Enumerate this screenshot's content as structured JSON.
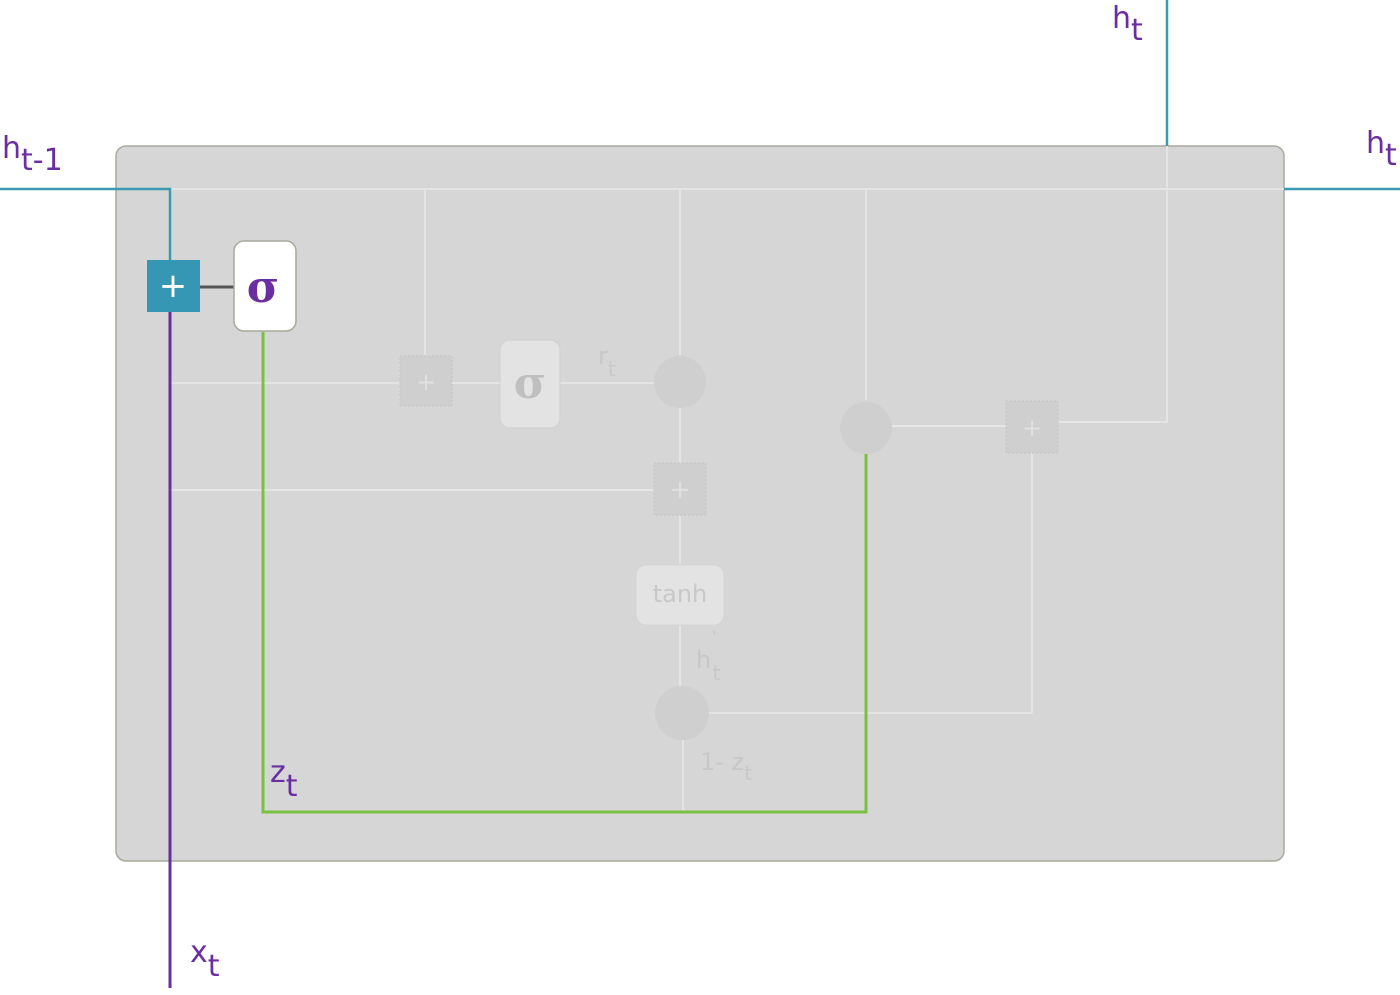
{
  "labels": {
    "h_prev": {
      "base": "h",
      "sub": "t-1"
    },
    "h_out_top": {
      "base": "h",
      "sub": "t"
    },
    "h_out_right": {
      "base": "h",
      "sub": "t"
    },
    "x_in": {
      "base": "x",
      "sub": "t"
    },
    "z": {
      "base": "z",
      "sub": "t"
    },
    "r": {
      "base": "r",
      "sub": "t"
    },
    "h_cand": {
      "base": "h",
      "prime": "'",
      "sub": "t"
    },
    "one_minus_z": {
      "base": "1- z",
      "sub": "t"
    }
  },
  "blocks": {
    "update_gate_sigma": "σ",
    "reset_gate_sigma": "σ",
    "tanh": "tanh",
    "concat_plus": "+",
    "cand_plus": "+",
    "out_plus": "+",
    "reset_plus": "+"
  },
  "colors": {
    "cell_bg": "#d6d6d6",
    "cell_border": "#a9aa9c",
    "hidden_line": "#3a9ab0",
    "input_line": "#6a2ea0",
    "z_line": "#7cc042",
    "faded_line": "#e6e6e6",
    "faded_node": "#cfcfcf",
    "plus_box": "#3597b4"
  }
}
